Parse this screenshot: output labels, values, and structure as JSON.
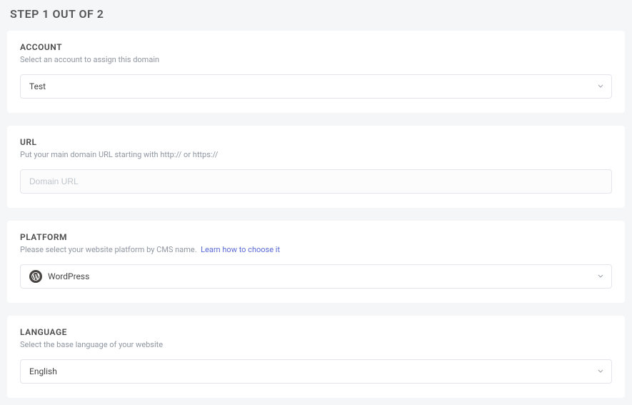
{
  "title": "STEP 1 OUT OF 2",
  "account": {
    "label": "ACCOUNT",
    "desc": "Select an account to assign this domain",
    "value": "Test"
  },
  "url": {
    "label": "URL",
    "desc": "Put your main domain URL starting with http:// or https://",
    "placeholder": "Domain URL"
  },
  "platform": {
    "label": "PLATFORM",
    "desc_text": "Please select your website platform by CMS name.",
    "desc_link": "Learn how to choose it",
    "value": "WordPress"
  },
  "language": {
    "label": "LANGUAGE",
    "desc": "Select the base language of your website",
    "value": "English"
  }
}
